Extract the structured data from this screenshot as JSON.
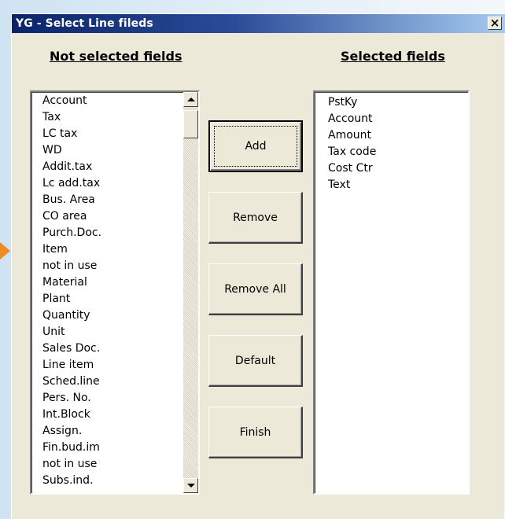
{
  "window": {
    "title": "YG - Select Line fileds",
    "close_glyph": "×"
  },
  "headings": {
    "not_selected": "Not selected fields",
    "selected": "Selected fields"
  },
  "not_selected_fields": [
    "Account",
    "Tax",
    "LC tax",
    "WD",
    "Addit.tax",
    "Lc add.tax",
    "Bus. Area",
    "CO area",
    "Purch.Doc.",
    "Item",
    "not in use",
    "Material",
    "Plant",
    "Quantity",
    "Unit",
    "Sales Doc.",
    "Line item",
    "Sched.line",
    "Pers. No.",
    "Int.Block",
    "Assign.",
    "Fin.bud.im",
    "not in use",
    "Subs.ind."
  ],
  "selected_fields": [
    "PstKy",
    "Account",
    "Amount",
    "Tax code",
    "Cost Ctr",
    "Text"
  ],
  "buttons": {
    "add": "Add",
    "remove": "Remove",
    "remove_all": "Remove All",
    "default": "Default",
    "finish": "Finish"
  },
  "colors": {
    "titlebar_start": "#0a246a",
    "titlebar_end": "#a6caf0",
    "dialog_bg": "#ece9d8",
    "accent_arrow": "#f08a24"
  }
}
